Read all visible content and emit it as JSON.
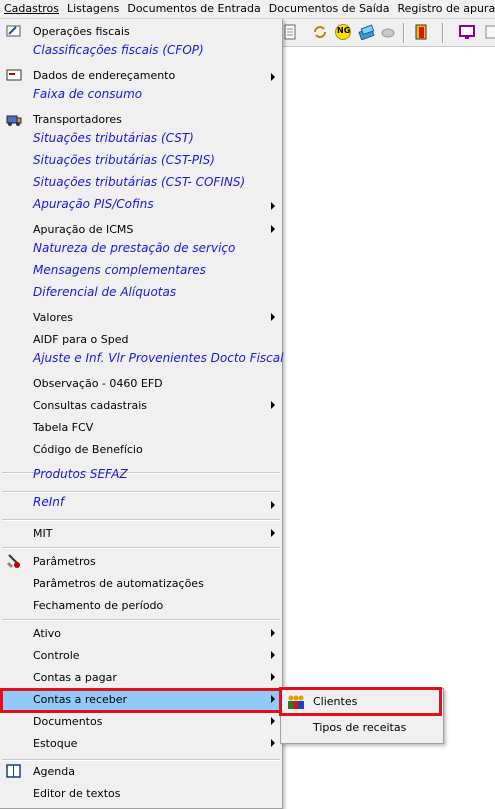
{
  "menubar": {
    "items": [
      "Cadastros",
      "Listagens",
      "Documentos de Entrada",
      "Documentos de Saída",
      "Registro de apuração do IC"
    ]
  },
  "menu": {
    "items": [
      {
        "label": "Operações fiscais",
        "style": "normal",
        "icon": "operations-icon"
      },
      {
        "label": "Classificações fiscais (CFOP)",
        "style": "blue"
      },
      {
        "label": "Dados de endereçamento",
        "style": "normal",
        "icon": "address-icon",
        "submenu": true
      },
      {
        "label": "Faixa de consumo",
        "style": "blue"
      },
      {
        "label": "Transportadores",
        "style": "normal",
        "icon": "truck-icon"
      },
      {
        "label": "Situações tributárias (CST)",
        "style": "blue"
      },
      {
        "label": "Situações tributárias (CST-PIS)",
        "style": "blue"
      },
      {
        "label": "Situações tributárias (CST- COFINS)",
        "style": "blue"
      },
      {
        "label": "Apuração PIS/Cofins",
        "style": "blue",
        "submenu": true
      },
      {
        "label": "Apuração de ICMS",
        "style": "normal",
        "submenu": true
      },
      {
        "label": "Natureza de prestação de serviço",
        "style": "blue"
      },
      {
        "label": "Mensagens complementares",
        "style": "blue"
      },
      {
        "label": "Diferencial de Alíquotas",
        "style": "blue"
      },
      {
        "label": "Valores",
        "style": "normal",
        "submenu": true
      },
      {
        "label": "AIDF para o Sped",
        "style": "normal"
      },
      {
        "label": "Ajuste e Inf. Vlr Provenientes Docto Fiscal",
        "style": "blue"
      },
      {
        "label": "Observação - 0460 EFD",
        "style": "normal"
      },
      {
        "label": "Consultas cadastrais",
        "style": "normal",
        "submenu": true
      },
      {
        "label": "Tabela FCV",
        "style": "normal"
      },
      {
        "label": "Código de Benefício",
        "style": "normal"
      },
      {
        "label": "Produtos SEFAZ",
        "style": "blue"
      },
      {
        "label": "ReInf",
        "style": "blue",
        "submenu": true
      },
      {
        "label": "MIT",
        "style": "normal",
        "submenu": true
      },
      {
        "label": "Parâmetros",
        "style": "normal",
        "icon": "parameters-icon"
      },
      {
        "label": "Parâmetros de automatizações",
        "style": "normal"
      },
      {
        "label": "Fechamento de período",
        "style": "normal"
      },
      {
        "label": "Ativo",
        "style": "normal",
        "submenu": true
      },
      {
        "label": "Controle",
        "style": "normal",
        "submenu": true
      },
      {
        "label": "Contas a pagar",
        "style": "normal",
        "submenu": true
      },
      {
        "label": "Contas a receber",
        "style": "normal",
        "submenu": true,
        "highlighted": true
      },
      {
        "label": "Documentos",
        "style": "normal",
        "submenu": true
      },
      {
        "label": "Estoque",
        "style": "normal",
        "submenu": true
      },
      {
        "label": "Agenda",
        "style": "normal",
        "icon": "agenda-icon"
      },
      {
        "label": "Editor de textos",
        "style": "normal"
      }
    ]
  },
  "submenu": {
    "items": [
      {
        "label": "Clientes",
        "icon": "clients-icon"
      },
      {
        "label": "Tipos de receitas"
      }
    ]
  },
  "toolbar": {
    "ng_label": "NG"
  },
  "colors": {
    "highlight": "#91c9f7",
    "annotation": "#e0101c",
    "blue_text": "#1919d2"
  }
}
